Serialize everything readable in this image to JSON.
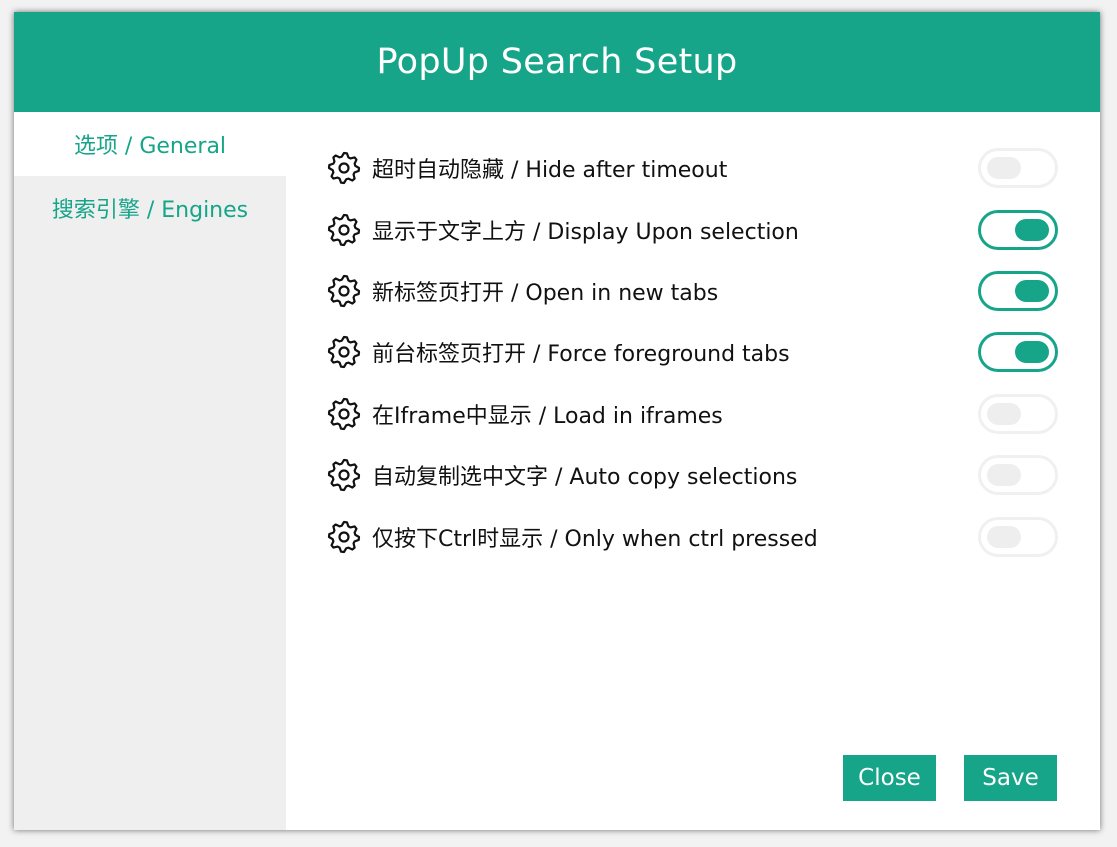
{
  "dialog": {
    "title": "PopUp Search Setup"
  },
  "sidebar": {
    "items": [
      {
        "label": "选项 / General",
        "active": true
      },
      {
        "label": "搜索引擎 / Engines",
        "active": false
      }
    ]
  },
  "options": [
    {
      "label": "超时自动隐藏 / Hide after timeout",
      "icon": "gear-icon",
      "enabled": false
    },
    {
      "label": "显示于文字上方 / Display Upon selection",
      "icon": "gear-icon",
      "enabled": true
    },
    {
      "label": "新标签页打开 / Open in new tabs",
      "icon": "gear-icon",
      "enabled": true
    },
    {
      "label": "前台标签页打开 / Force foreground tabs",
      "icon": "gear-icon",
      "enabled": true
    },
    {
      "label": "在Iframe中显示 / Load in iframes",
      "icon": "gear-icon",
      "enabled": false
    },
    {
      "label": "自动复制选中文字 / Auto copy selections",
      "icon": "gear-icon",
      "enabled": false
    },
    {
      "label": "仅按下Ctrl时显示 / Only when ctrl pressed",
      "icon": "gear-icon",
      "enabled": false
    }
  ],
  "buttons": {
    "close_label": "Close",
    "save_label": "Save"
  },
  "colors": {
    "accent": "#17a589",
    "sidebar_bg": "#efefef",
    "toggle_off": "#eeeeee"
  }
}
